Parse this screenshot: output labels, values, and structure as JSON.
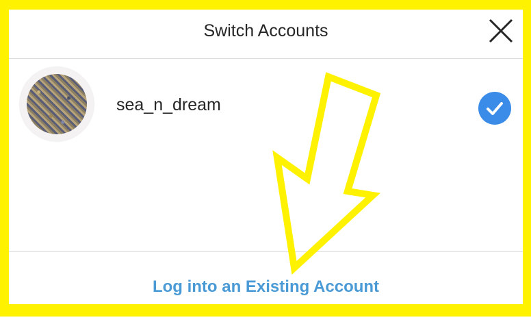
{
  "dialog": {
    "title": "Switch Accounts",
    "close_icon": "close-icon"
  },
  "accounts": [
    {
      "username": "sea_n_dream",
      "selected": true,
      "avatar_icon": "avatar",
      "selected_icon": "checkmark-icon",
      "selected_color": "#3b8ce8"
    }
  ],
  "footer": {
    "login_label": "Log into an Existing Account",
    "link_color": "#4a9ad6"
  },
  "annotation": {
    "icon": "arrow-icon",
    "color": "#fff200"
  }
}
